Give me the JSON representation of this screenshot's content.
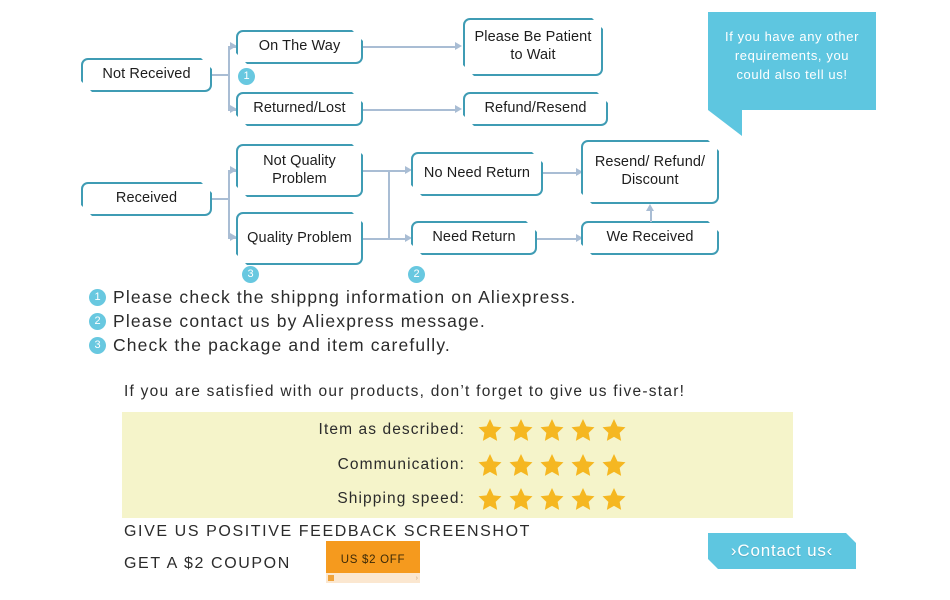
{
  "colors": {
    "accent_cyan": "#5ec6e0",
    "box_border": "#3f9cb4",
    "connector": "#a9bdd4",
    "panel_yellow": "#f5f4ca",
    "star_gold": "#f5b721",
    "coupon_orange": "#f59a1e"
  },
  "flow": {
    "not_received": {
      "root": "Not Received",
      "branch_a": "On The Way",
      "branch_a_result": "Please Be Patient to Wait",
      "branch_b": "Returned/Lost",
      "branch_b_result": "Refund/Resend",
      "badge": "1"
    },
    "received": {
      "root": "Received",
      "branch_a": "Not Quality Problem",
      "branch_b": "Quality Problem",
      "mid_a": "No Need Return",
      "mid_b": "Need Return",
      "end_a": "Resend/ Refund/ Discount",
      "end_b": "We Received",
      "badge_quality": "3",
      "badge_return": "2"
    }
  },
  "bubble": {
    "text": "If you have any other requirements, you could also tell us!"
  },
  "notes": [
    {
      "num": "1",
      "text": "Please check the shippng information on Aliexpress."
    },
    {
      "num": "2",
      "text": "Please contact us by Aliexpress message."
    },
    {
      "num": "3",
      "text": "Check the package and item carefully."
    }
  ],
  "feedback": {
    "headline": "If you are satisfied with our products, don’t forget to give us five-star!",
    "ratings": [
      {
        "label": "Item as described:",
        "stars": 5
      },
      {
        "label": "Communication:",
        "stars": 5
      },
      {
        "label": "Shipping speed:",
        "stars": 5
      }
    ]
  },
  "promo": {
    "line1": "GIVE US POSITIVE FEEDBACK SCREENSHOT",
    "line2": "GET A $2 COUPON",
    "coupon_label": "US $2 OFF",
    "coupon_chevron": "›"
  },
  "contact": {
    "label": "›Contact us‹"
  }
}
